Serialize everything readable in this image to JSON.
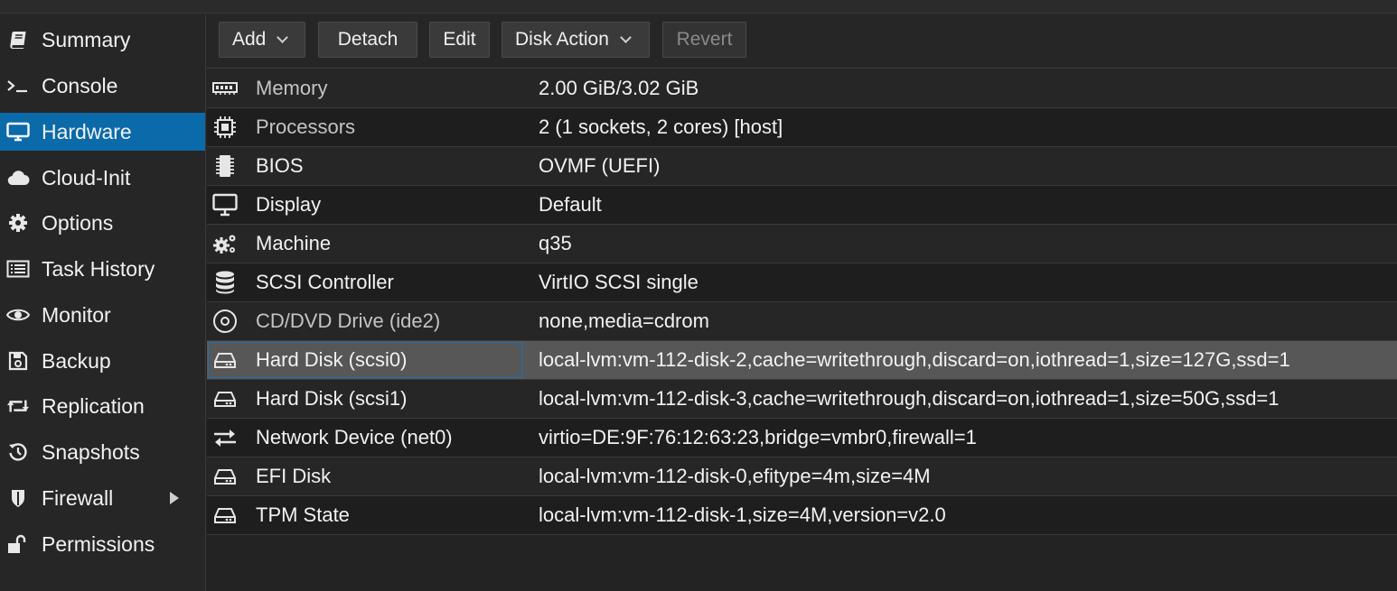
{
  "sidebar": {
    "items": [
      {
        "label": "Summary",
        "icon": "book-icon"
      },
      {
        "label": "Console",
        "icon": "terminal-icon"
      },
      {
        "label": "Hardware",
        "icon": "monitor-icon",
        "active": true
      },
      {
        "label": "Cloud-Init",
        "icon": "cloud-icon"
      },
      {
        "label": "Options",
        "icon": "gear-icon"
      },
      {
        "label": "Task History",
        "icon": "list-icon"
      },
      {
        "label": "Monitor",
        "icon": "eye-icon"
      },
      {
        "label": "Backup",
        "icon": "floppy-icon"
      },
      {
        "label": "Replication",
        "icon": "retweet-icon"
      },
      {
        "label": "Snapshots",
        "icon": "history-icon"
      },
      {
        "label": "Firewall",
        "icon": "shield-icon",
        "has_submenu": true
      },
      {
        "label": "Permissions",
        "icon": "unlock-icon"
      }
    ]
  },
  "toolbar": {
    "add_label": "Add",
    "detach_label": "Detach",
    "edit_label": "Edit",
    "disk_action_label": "Disk Action",
    "revert_label": "Revert"
  },
  "hardware": {
    "rows": [
      {
        "name": "Memory",
        "value": "2.00 GiB/3.02 GiB",
        "icon": "memory-icon"
      },
      {
        "name": "Processors",
        "value": "2 (1 sockets, 2 cores) [host]",
        "icon": "cpu-icon"
      },
      {
        "name": "BIOS",
        "value": "OVMF (UEFI)",
        "icon": "microchip-icon"
      },
      {
        "name": "Display",
        "value": "Default",
        "icon": "desktop-icon"
      },
      {
        "name": "Machine",
        "value": "q35",
        "icon": "cogs-icon"
      },
      {
        "name": "SCSI Controller",
        "value": "VirtIO SCSI single",
        "icon": "database-icon"
      },
      {
        "name": "CD/DVD Drive (ide2)",
        "value": "none,media=cdrom",
        "icon": "cdrom-icon"
      },
      {
        "name": "Hard Disk (scsi0)",
        "value": "local-lvm:vm-112-disk-2,cache=writethrough,discard=on,iothread=1,size=127G,ssd=1",
        "icon": "hdd-icon",
        "selected": true
      },
      {
        "name": "Hard Disk (scsi1)",
        "value": "local-lvm:vm-112-disk-3,cache=writethrough,discard=on,iothread=1,size=50G,ssd=1",
        "icon": "hdd-icon"
      },
      {
        "name": "Network Device (net0)",
        "value": "virtio=DE:9F:76:12:63:23,bridge=vmbr0,firewall=1",
        "icon": "exchange-icon"
      },
      {
        "name": "EFI Disk",
        "value": "local-lvm:vm-112-disk-0,efitype=4m,size=4M",
        "icon": "hdd-icon"
      },
      {
        "name": "TPM State",
        "value": "local-lvm:vm-112-disk-1,size=4M,version=v2.0",
        "icon": "hdd-icon"
      }
    ]
  },
  "colors": {
    "accent": "#0b6aa9",
    "selected_row": "#575757",
    "background": "#232323"
  }
}
